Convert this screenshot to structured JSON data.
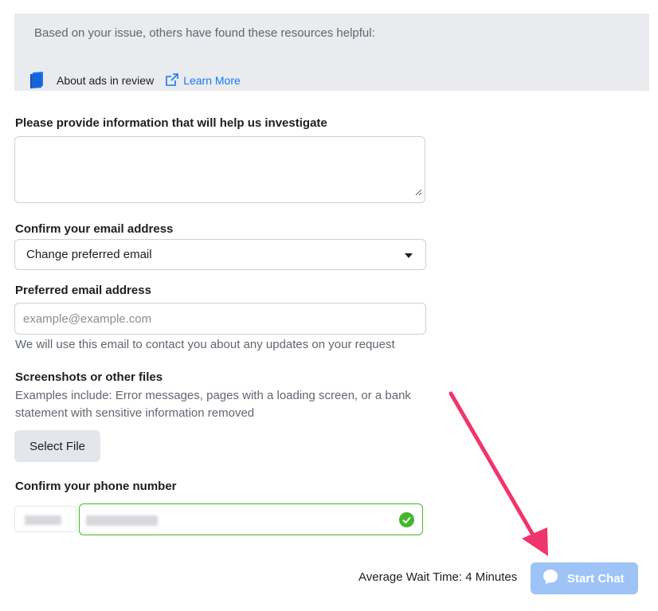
{
  "resources": {
    "intro": "Based on your issue, others have found these resources helpful:",
    "items": [
      {
        "title": "About ads in review",
        "link_label": "Learn More"
      }
    ]
  },
  "form": {
    "investigate_label": "Please provide information that will help us investigate",
    "email_confirm_label": "Confirm your email address",
    "email_confirm_selected": "Change preferred email",
    "preferred_email_label": "Preferred email address",
    "preferred_email_placeholder": "example@example.com",
    "preferred_email_helper": "We will use this email to contact you about any updates on your request",
    "files_label": "Screenshots or other files",
    "files_helper": "Examples include: Error messages, pages with a loading screen, or a bank statement with sensitive information removed",
    "select_file_label": "Select File",
    "phone_label": "Confirm your phone number"
  },
  "footer": {
    "wait_text": "Average Wait Time: 4 Minutes",
    "chat_button_label": "Start Chat"
  },
  "icons": {
    "book": "book-icon",
    "external_link": "external-link-icon",
    "chevron": "chevron-down-icon",
    "check": "check-circle-icon",
    "chat": "chat-bubble-icon",
    "annotation": "arrow-annotation"
  },
  "colors": {
    "accent": "#1877f2",
    "success": "#42b72a",
    "chat_button": "#9dc3f7",
    "annotation_arrow": "#f0356c"
  }
}
